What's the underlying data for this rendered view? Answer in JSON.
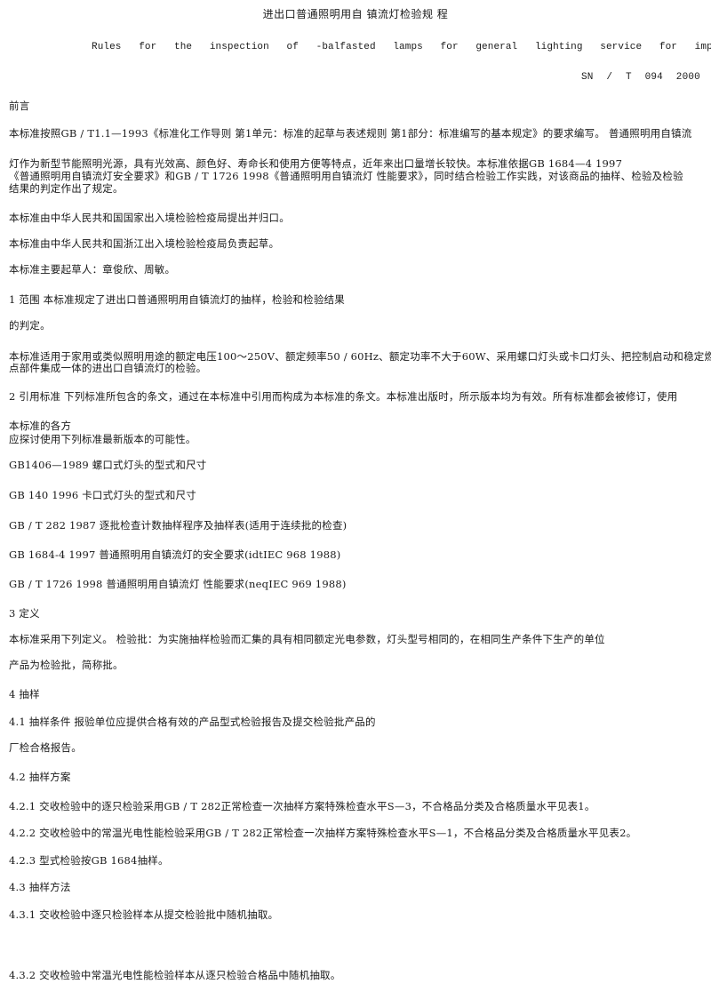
{
  "document": {
    "title": "进出口普通照明用自 镇流灯检验规 程",
    "subtitle": "Rules for the inspection of -balfasted lamps for general lighting service for import and export",
    "standard_number": "SN / T 094 2000"
  },
  "foreword": {
    "heading": "前言",
    "p1_line1": "本标准按照GB / T1.1—1993《标准化工作导则 第1单元：标准的起草与表述规则 第1部分：标准编写的基本规定》的要求编写。 普通照明用自镇流",
    "p1_line2": "灯作为新型节能照明光源，具有光效高、颜色好、寿命长和使用方便等特点，近年来出口量增长较快。本标准依据GB   1684—4 1997",
    "p1_line3": "《普通照明用自镇流灯安全要求》和GB / T   1726   1998《普通照明用自镇流灯 性能要求》，同时结合检验工作实践，对该商品的抽样、检验及检验",
    "p1_line4": "结果的判定作出了规定。",
    "p2": "本标准由中华人民共和国国家出入境检验检疫局提出并归口。",
    "p3": "本标准由中华人民共和国浙江出入境检验检疫局负责起草。",
    "p4": "本标准主要起草人：章俊欣、周敏。"
  },
  "section1": {
    "line1": "1  范围 本标准规定了进出口普通照明用自镇流灯的抽样，检验和检验结果",
    "line2": "的判定。",
    "line3": "本标准适用于家用或类似照明用途的额定电压100～250V、额定频率50 / 60Hz、额定功率不大于60W、采用螺口灯头或卡口灯头、把控制启动和稳定燃",
    "line4": "点部件集成一体的进出口自镇流灯的检验。"
  },
  "section2": {
    "line1": "2  引用标准 下列标准所包含的条文，通过在本标准中引用而构成为本标准的条文。本标准出版时，所示版本均为有效。所有标准都会被修订，使用",
    "line2": "本标准的各方",
    "line3": "应探讨使用下列标准最新版本的可能性。",
    "refs": [
      "GB1406—1989 螺口式灯头的型式和尺寸",
      "GB   140  1996 卡口式灯头的型式和尺寸",
      "GB / T   282   1987 逐批检查计数抽样程序及抽样表(适用于连续批的检查)",
      "GB   1684-4 1997 普通照明用自镇流灯的安全要求(idtIEC   968 1988)",
      "GB / T   1726   1998 普通照明用自镇流灯 性能要求(neqIEC   969 1988)"
    ]
  },
  "section3": {
    "heading": "3  定义",
    "line1": "本标准采用下列定义。  检验批：为实施抽样检验而汇集的具有相同额定光电参数，灯头型号相同的，在相同生产条件下生产的单位",
    "line2": "产品为检验批，简称批。"
  },
  "section4": {
    "heading": "4  抽样",
    "s41_line1": "4.1  抽样条件 报验单位应提供合格有效的产品型式检验报告及提交检验批产品的",
    "s41_line2": "厂检合格报告。",
    "s42_heading": "4.2  抽样方案",
    "s421": "4.2.1  交收检验中的逐只检验采用GB / T   282正常检查一次抽样方案特殊检查水平S—3，不合格品分类及合格质量水平见表1。",
    "s422": "4.2.2  交收检验中的常温光电性能检验采用GB / T   282正常检查一次抽样方案特殊检查水平S—1，不合格品分类及合格质量水平见表2。",
    "s423": "4.2.3  型式检验按GB   1684抽样。",
    "s43_heading": "4.3  抽样方法",
    "s431": "4.3.1  交收检验中逐只检验样本从提交检验批中随机抽取。",
    "s432": "4.3.2  交收检验中常温光电性能检验样本从逐只检验合格品中随机抽取。"
  }
}
